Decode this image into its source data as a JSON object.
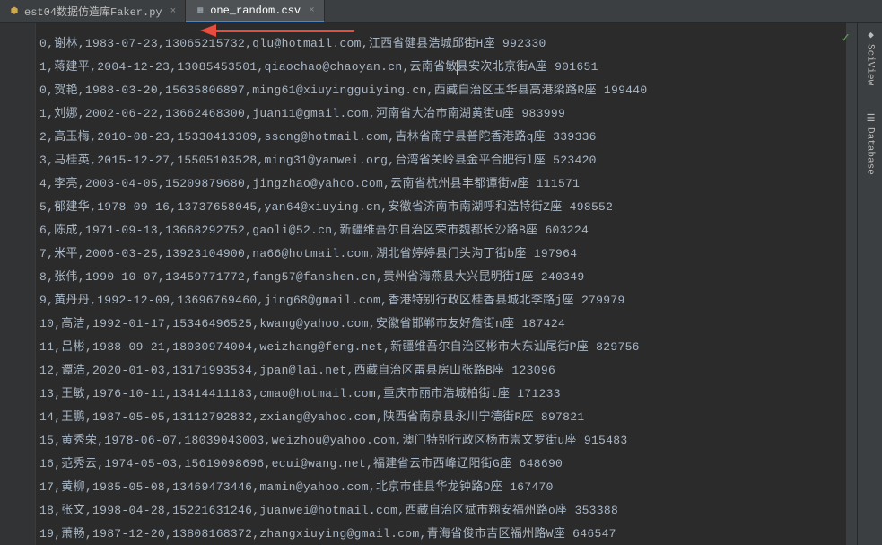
{
  "tabs": [
    {
      "label": "est04数据仿造库Faker.py",
      "closable": true,
      "active": false
    },
    {
      "label": "one_random.csv",
      "closable": true,
      "active": true
    }
  ],
  "caret_line_index": 1,
  "caret_after_col": 4,
  "rows": [
    {
      "idx": "0",
      "name": "谢林",
      "date": "1983-07-23",
      "phone": "13065215732",
      "email": "qlu@hotmail.com",
      "address": "江西省健县浩城邱街H座",
      "code": "992330"
    },
    {
      "idx": "1",
      "name": "蒋建平",
      "date": "2004-12-23",
      "phone": "13085453501",
      "email": "qiaochao@chaoyan.cn",
      "address": "云南省敏县安次北京街A座",
      "code": "901651"
    },
    {
      "idx": "0",
      "name": "贺艳",
      "date": "1988-03-20",
      "phone": "15635806897",
      "email": "ming61@xiuyingguiying.cn",
      "address": "西藏自治区玉华县高港梁路R座",
      "code": "199440"
    },
    {
      "idx": "1",
      "name": "刘娜",
      "date": "2002-06-22",
      "phone": "13662468300",
      "email": "juan11@gmail.com",
      "address": "河南省大冶市南湖黄街u座",
      "code": "983999"
    },
    {
      "idx": "2",
      "name": "高玉梅",
      "date": "2010-08-23",
      "phone": "15330413309",
      "email": "ssong@hotmail.com",
      "address": "吉林省南宁县普陀香港路q座",
      "code": "339336"
    },
    {
      "idx": "3",
      "name": "马桂英",
      "date": "2015-12-27",
      "phone": "15505103528",
      "email": "ming31@yanwei.org",
      "address": "台湾省关岭县金平合肥街l座",
      "code": "523420"
    },
    {
      "idx": "4",
      "name": "李亮",
      "date": "2003-04-05",
      "phone": "15209879680",
      "email": "jingzhao@yahoo.com",
      "address": "云南省杭州县丰都谭街w座",
      "code": "111571"
    },
    {
      "idx": "5",
      "name": "郁建华",
      "date": "1978-09-16",
      "phone": "13737658045",
      "email": "yan64@xiuying.cn",
      "address": "安徽省济南市南湖呼和浩特街Z座",
      "code": "498552"
    },
    {
      "idx": "6",
      "name": "陈成",
      "date": "1971-09-13",
      "phone": "13668292752",
      "email": "gaoli@52.cn",
      "address": "新疆维吾尔自治区荣市魏都长沙路B座",
      "code": "603224"
    },
    {
      "idx": "7",
      "name": "米平",
      "date": "2006-03-25",
      "phone": "13923104900",
      "email": "na66@hotmail.com",
      "address": "湖北省婷婷县门头沟丁街b座",
      "code": "197964"
    },
    {
      "idx": "8",
      "name": "张伟",
      "date": "1990-10-07",
      "phone": "13459771772",
      "email": "fang57@fanshen.cn",
      "address": "贵州省海燕县大兴昆明街I座",
      "code": "240349"
    },
    {
      "idx": "9",
      "name": "黄丹丹",
      "date": "1992-12-09",
      "phone": "13696769460",
      "email": "jing68@gmail.com",
      "address": "香港特别行政区桂香县城北李路j座",
      "code": "279979"
    },
    {
      "idx": "10",
      "name": "高洁",
      "date": "1992-01-17",
      "phone": "15346496525",
      "email": "kwang@yahoo.com",
      "address": "安徽省邯郸市友好詹街n座",
      "code": "187424"
    },
    {
      "idx": "11",
      "name": "吕彬",
      "date": "1988-09-21",
      "phone": "18030974004",
      "email": "weizhang@feng.net",
      "address": "新疆维吾尔自治区彬市大东汕尾街P座",
      "code": "829756"
    },
    {
      "idx": "12",
      "name": "谭浩",
      "date": "2020-01-03",
      "phone": "13171993534",
      "email": "jpan@lai.net",
      "address": "西藏自治区雷县房山张路B座",
      "code": "123096"
    },
    {
      "idx": "13",
      "name": "王敏",
      "date": "1976-10-11",
      "phone": "13414411183",
      "email": "cmao@hotmail.com",
      "address": "重庆市丽市浩城柏街t座",
      "code": "171233"
    },
    {
      "idx": "14",
      "name": "王鹏",
      "date": "1987-05-05",
      "phone": "13112792832",
      "email": "zxiang@yahoo.com",
      "address": "陕西省南京县永川宁德街R座",
      "code": "897821"
    },
    {
      "idx": "15",
      "name": "黄秀荣",
      "date": "1978-06-07",
      "phone": "18039043003",
      "email": "weizhou@yahoo.com",
      "address": "澳门特别行政区杨市崇文罗街u座",
      "code": "915483"
    },
    {
      "idx": "16",
      "name": "范秀云",
      "date": "1974-05-03",
      "phone": "15619098696",
      "email": "ecui@wang.net",
      "address": "福建省云市西峰辽阳街G座",
      "code": "648690"
    },
    {
      "idx": "17",
      "name": "黄柳",
      "date": "1985-05-08",
      "phone": "13469473446",
      "email": "mamin@yahoo.com",
      "address": "北京市佳县华龙钟路D座",
      "code": "167470"
    },
    {
      "idx": "18",
      "name": "张文",
      "date": "1998-04-28",
      "phone": "15221631246",
      "email": "juanwei@hotmail.com",
      "address": "西藏自治区斌市翔安福州路o座",
      "code": "353388"
    },
    {
      "idx": "19",
      "name": "萧畅",
      "date": "1987-12-20",
      "phone": "13808168372",
      "email": "zhangxiuying@gmail.com",
      "address": "青海省俊市吉区福州路W座",
      "code": "646547"
    }
  ],
  "sidebar": {
    "item1": "SciView",
    "item2": "Database"
  },
  "status": {
    "ok_icon": "✓"
  }
}
